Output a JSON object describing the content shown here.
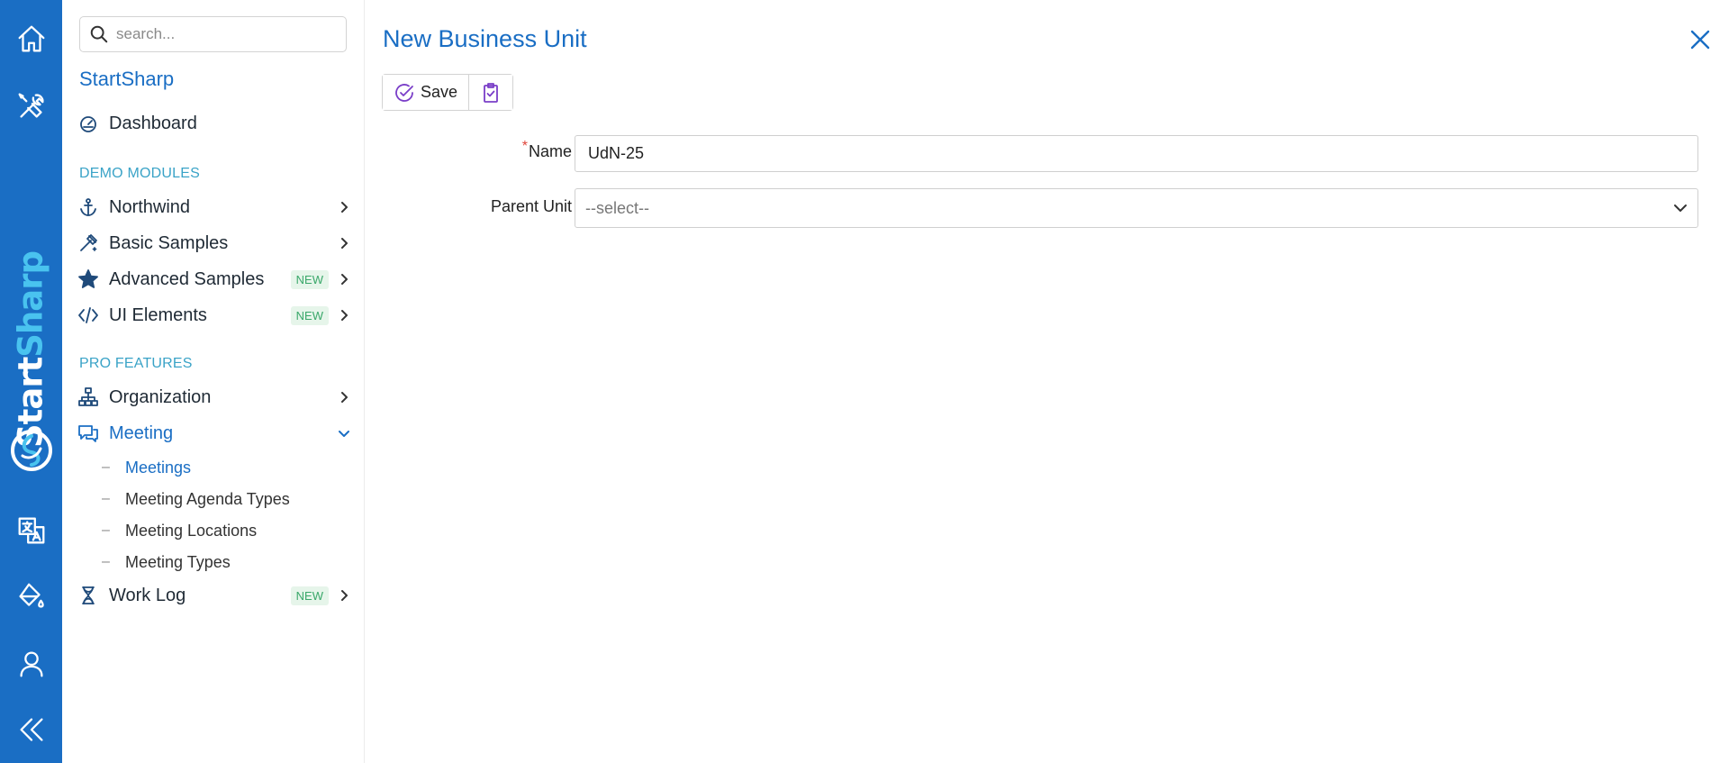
{
  "rail": {
    "items": [
      {
        "icon": "home-icon"
      },
      {
        "icon": "tools-icon"
      },
      {
        "icon": "translate-icon"
      },
      {
        "icon": "paint-bucket-icon"
      },
      {
        "icon": "user-icon"
      },
      {
        "icon": "double-chevron-left-icon"
      }
    ],
    "logo_part1": "Start",
    "logo_part2": "Sharp",
    "accent": "#1a6ec4",
    "logo_highlight": "#49c3ef"
  },
  "sidebar": {
    "search_placeholder": "search...",
    "brand": "StartSharp",
    "dashboard_label": "Dashboard",
    "demo_modules_heading": "DEMO MODULES",
    "pro_features_heading": "PRO FEATURES",
    "items": {
      "northwind": {
        "label": "Northwind"
      },
      "basic_samples": {
        "label": "Basic Samples"
      },
      "advanced_samples": {
        "label": "Advanced Samples",
        "badge": "NEW"
      },
      "ui_elements": {
        "label": "UI Elements",
        "badge": "NEW"
      },
      "organization": {
        "label": "Organization"
      },
      "meeting": {
        "label": "Meeting"
      },
      "work_log": {
        "label": "Work Log",
        "badge": "NEW"
      }
    },
    "meeting_sub": {
      "meetings": "Meetings",
      "agenda_types": "Meeting Agenda Types",
      "locations": "Meeting Locations",
      "types": "Meeting Types"
    },
    "sub_dash": "–"
  },
  "dialog": {
    "title": "New Business Unit",
    "save_label": "Save",
    "name_label": "Name",
    "required_mark": "*",
    "name_value": "UdN-25",
    "parent_label": "Parent Unit",
    "parent_value": "--select--"
  }
}
